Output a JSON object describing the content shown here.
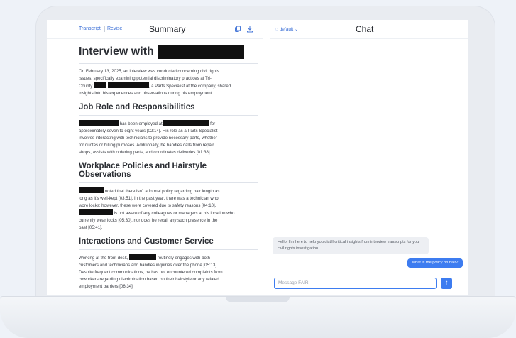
{
  "left_pane": {
    "tabs": [
      "Transcript",
      "Revise"
    ],
    "title": "Summary",
    "icons": [
      "copy-icon",
      "download-icon"
    ]
  },
  "document": {
    "title": "Interview with",
    "intro": [
      "On February 13, 2025, an interview was conducted concerning civil rights",
      "issues, specifically examining potential discriminatory practices at Tri-",
      "County",
      ", a Parts Specialist at the company, shared",
      "insights into his experiences and observations during his employment."
    ],
    "sections": [
      {
        "heading": "Job Role and Responsibilities",
        "lines": [
          "has been employed at",
          "for",
          "approximately seven to eight years [02:14]. His role as a Parts Specialist",
          "involves interacting with technicians to provide necessary parts, whether",
          "for quotes or billing purposes. Additionally, he handles calls from repair",
          "shops, assists with ordering parts, and coordinates deliveries [01:38]."
        ]
      },
      {
        "heading": "Workplace Policies and Hairstyle Observations",
        "lines": [
          "noted that there isn't a formal policy regarding hair length as",
          "long as it's well-kept [03:51]. In the past year, there was a technician who",
          "wore locks; however, these were covered due to safety reasons [04:10].",
          "is not aware of any colleagues or managers at his location who",
          "currently wear locks [05:30], nor does he recall any such presence in the",
          "past [05:41]."
        ]
      },
      {
        "heading": "Interactions and Customer Service",
        "lines": [
          "Working at the front desk,",
          "routinely engages with both",
          "customers and technicians and handles inquiries over the phone [05:13].",
          "Despite frequent communications, he has not encountered complaints from",
          "coworkers regarding discrimination based on their hairstyle or any related",
          "employment barriers [06:34]."
        ]
      }
    ]
  },
  "right_pane": {
    "model_selector": "default",
    "title": "Chat",
    "bot_message": "Hello! I'm here to help you distill critical insights from interview transcripts for your civil rights investigation.",
    "user_message": "what is the policy on hair?",
    "input_placeholder": "Message FAIR",
    "send_icon": "↑"
  }
}
